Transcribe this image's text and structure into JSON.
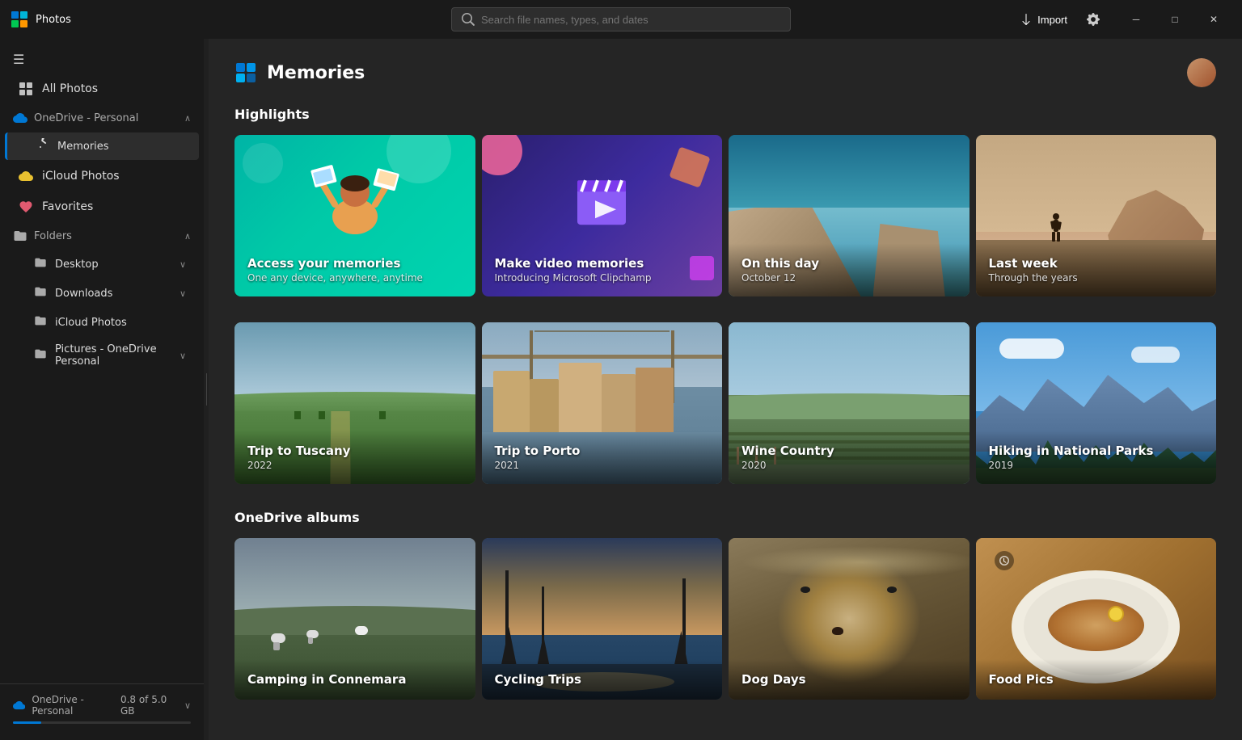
{
  "titlebar": {
    "app_name": "Photos",
    "search_placeholder": "Search file names, types, and dates",
    "import_label": "Import",
    "window_minimize": "─",
    "window_maximize": "□",
    "window_close": "✕"
  },
  "sidebar": {
    "hamburger_label": "≡",
    "all_photos_label": "All Photos",
    "onedrive_section_label": "OneDrive - Personal",
    "memories_label": "Memories",
    "icloud_photos_label": "iCloud Photos",
    "favorites_label": "Favorites",
    "folders_section_label": "Folders",
    "desktop_label": "Desktop",
    "downloads_label": "Downloads",
    "icloud_photos_folder_label": "iCloud Photos",
    "pictures_label": "Pictures - OneDrive Personal",
    "footer_onedrive_label": "OneDrive - Personal",
    "footer_storage": "0.8 of 5.0 GB"
  },
  "page": {
    "title": "Memories",
    "highlights_section": "Highlights",
    "onedrive_albums_section": "OneDrive albums"
  },
  "highlights": [
    {
      "id": "access-memories",
      "title": "Access your memories",
      "subtitle": "One any device, anywhere, anytime",
      "type": "promo-access"
    },
    {
      "id": "video-memories",
      "title": "Make video memories",
      "subtitle": "Introducing Microsoft Clipchamp",
      "type": "promo-video"
    },
    {
      "id": "on-this-day",
      "title": "On this day",
      "subtitle": "October 12",
      "type": "photo-scene"
    },
    {
      "id": "last-week",
      "title": "Last week",
      "subtitle": "Through the years",
      "type": "photo-scene"
    }
  ],
  "trips": [
    {
      "id": "tuscany",
      "title": "Trip to Tuscany",
      "year": "2022"
    },
    {
      "id": "porto",
      "title": "Trip to Porto",
      "year": "2021"
    },
    {
      "id": "wine-country",
      "title": "Wine Country",
      "year": "2020"
    },
    {
      "id": "hiking",
      "title": "Hiking in National Parks",
      "year": "2019"
    }
  ],
  "albums": [
    {
      "id": "connemara",
      "title": "Camping in Connemara"
    },
    {
      "id": "cycling",
      "title": "Cycling Trips"
    },
    {
      "id": "dog",
      "title": "Dog Days"
    },
    {
      "id": "food",
      "title": "Food Pics"
    }
  ]
}
